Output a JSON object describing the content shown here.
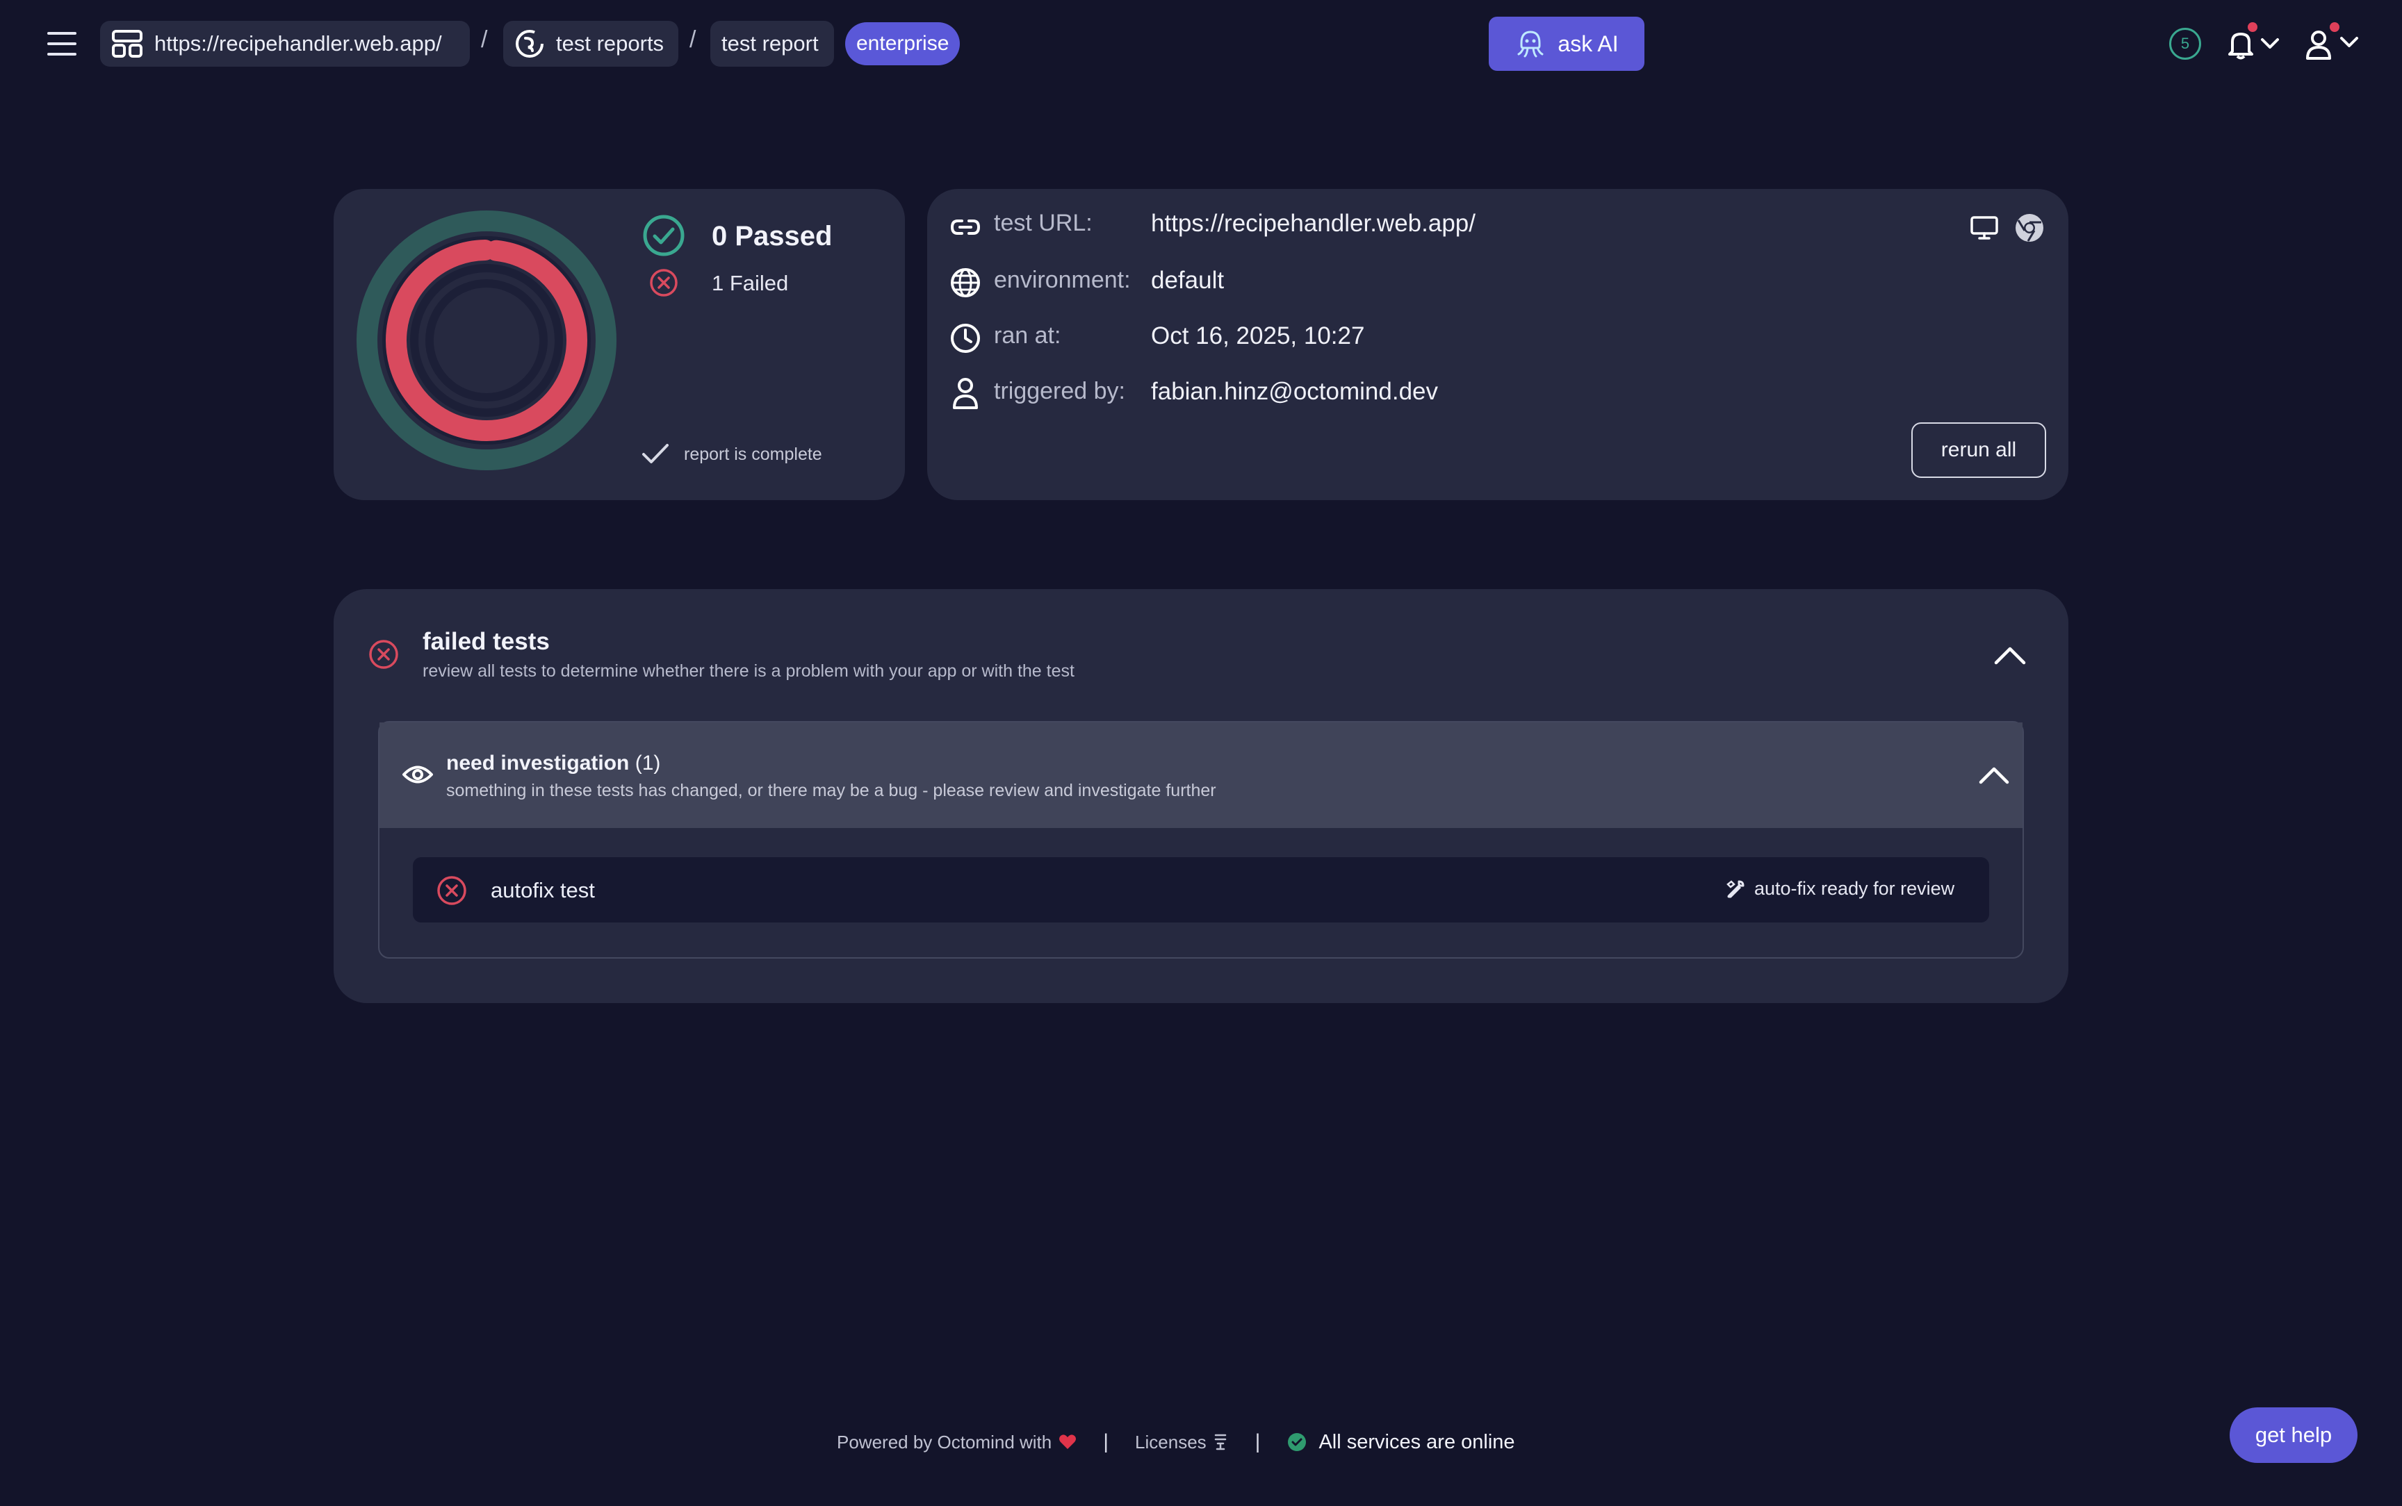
{
  "topbar": {
    "crumbs": {
      "project": "https://recipehandler.web.app/",
      "reports": "test reports",
      "report": "test report"
    },
    "separator": "/",
    "plan_badge": "enterprise",
    "ask_ai": "ask AI",
    "notification_count": "5"
  },
  "summary": {
    "passed_label": "0 Passed",
    "failed_label": "1 Failed",
    "passed": 0,
    "failed": 1,
    "status": "report is complete"
  },
  "details": {
    "url": {
      "label": "test URL:",
      "value": "https://recipehandler.web.app/"
    },
    "environment": {
      "label": "environment:",
      "value": "default"
    },
    "ran_at": {
      "label": "ran at:",
      "value": "Oct 16, 2025, 10:27"
    },
    "triggered_by": {
      "label": "triggered by:",
      "value": "fabian.hinz@octomind.dev"
    },
    "rerun_label": "rerun all"
  },
  "failed_tests": {
    "title": "failed tests",
    "subtitle": "review all tests to determine whether there is a problem with your app or with the test",
    "groups": [
      {
        "title": "need investigation",
        "count": "(1)",
        "subtitle": "something in these tests has changed, or there may be a bug - please review and investigate further",
        "tests": [
          {
            "name": "autofix test",
            "status": "auto-fix ready for review"
          }
        ]
      }
    ]
  },
  "footer": {
    "powered": "Powered by Octomind with",
    "licenses": "Licenses",
    "divider": "|",
    "status": "All services are online"
  },
  "help_label": "get help",
  "colors": {
    "background": "#13142a",
    "card": "#262940",
    "accent": "#5b57d6",
    "pass": "#3aa890",
    "fail": "#d94a5e"
  },
  "icons": [
    "menu-icon",
    "project-icon",
    "reports-icon",
    "octopus-icon",
    "bell-icon",
    "user-icon",
    "chevron-down-icon",
    "check-circle-icon",
    "x-circle-icon",
    "check-icon",
    "link-icon",
    "globe-icon",
    "clock-icon",
    "person-icon",
    "monitor-icon",
    "chrome-icon",
    "chevron-up-icon",
    "eye-icon",
    "wrench-icon",
    "heart-icon",
    "license-icon"
  ]
}
